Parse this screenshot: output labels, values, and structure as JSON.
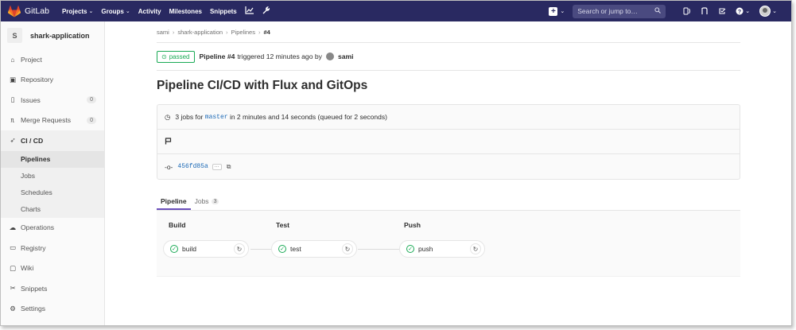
{
  "nav": {
    "brand": "GitLab",
    "links": [
      {
        "label": "Projects",
        "caret": true
      },
      {
        "label": "Groups",
        "caret": true
      },
      {
        "label": "Activity",
        "caret": false
      },
      {
        "label": "Milestones",
        "caret": false
      },
      {
        "label": "Snippets",
        "caret": false
      }
    ],
    "search_placeholder": "Search or jump to…",
    "brand_color": "#292961"
  },
  "sidebar": {
    "project_initial": "S",
    "project_name": "shark-application",
    "items": [
      {
        "label": "Project",
        "icon": "home-icon"
      },
      {
        "label": "Repository",
        "icon": "book-icon"
      },
      {
        "label": "Issues",
        "icon": "issues-icon",
        "count": "0"
      },
      {
        "label": "Merge Requests",
        "icon": "merge-request-icon",
        "count": "0"
      },
      {
        "label": "CI / CD",
        "icon": "rocket-icon"
      },
      {
        "label": "Operations",
        "icon": "cloud-gear-icon"
      },
      {
        "label": "Registry",
        "icon": "container-icon"
      },
      {
        "label": "Wiki",
        "icon": "wiki-icon"
      },
      {
        "label": "Snippets",
        "icon": "scissors-icon"
      },
      {
        "label": "Settings",
        "icon": "gear-icon"
      }
    ],
    "cicd_sub": [
      "Pipelines",
      "Jobs",
      "Schedules",
      "Charts"
    ]
  },
  "breadcrumb": [
    "sami",
    "shark-application",
    "Pipelines",
    "#4"
  ],
  "pipeline": {
    "status": "passed",
    "name": "Pipeline #4",
    "triggered_text": "triggered 12 minutes ago by",
    "user": "sami",
    "title": "Pipeline CI/CD with Flux and GitOps",
    "jobs_prefix": "3 jobs for",
    "branch": "master",
    "jobs_suffix": "in 2 minutes and 14 seconds (queued for 2 seconds)",
    "commit": "456fd85a",
    "ellipsis": "···"
  },
  "tabs": [
    {
      "label": "Pipeline"
    },
    {
      "label": "Jobs",
      "count": "3"
    }
  ],
  "stages": [
    {
      "title": "Build",
      "job": "build"
    },
    {
      "title": "Test",
      "job": "test"
    },
    {
      "title": "Push",
      "job": "push"
    }
  ]
}
